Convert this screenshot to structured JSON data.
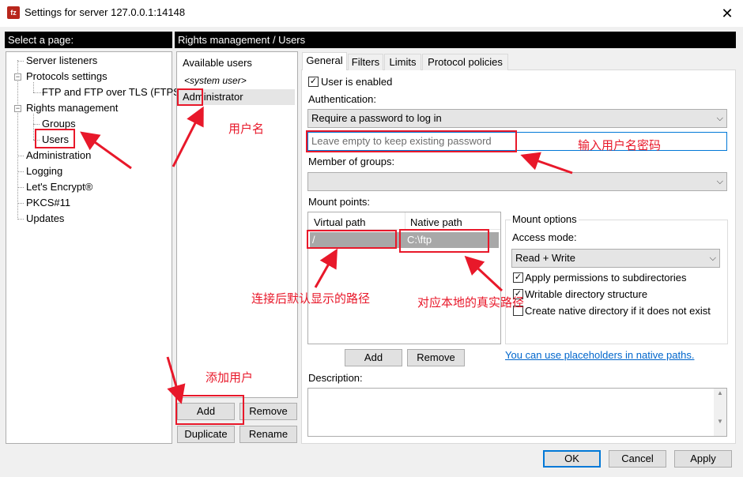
{
  "window": {
    "title": "Settings for server 127.0.0.1:14148",
    "app_icon": "fz",
    "close": "✕"
  },
  "left_pane": {
    "header": "Select a page:",
    "tree": [
      {
        "label": "Server listeners"
      },
      {
        "label": "Protocols settings"
      },
      {
        "label": "FTP and FTP over TLS (FTPS)"
      },
      {
        "label": "Rights management"
      },
      {
        "label": "Groups"
      },
      {
        "label": "Users"
      },
      {
        "label": "Administration"
      },
      {
        "label": "Logging"
      },
      {
        "label": "Let's Encrypt®"
      },
      {
        "label": "PKCS#11"
      },
      {
        "label": "Updates"
      }
    ]
  },
  "right_header": "Rights management / Users",
  "users_panel": {
    "title": "Available users",
    "items": [
      "<system user>",
      "Administrator"
    ],
    "buttons": {
      "add": "Add",
      "remove": "Remove",
      "duplicate": "Duplicate",
      "rename": "Rename"
    }
  },
  "tabs": [
    "General",
    "Filters",
    "Limits",
    "Protocol policies"
  ],
  "general": {
    "user_enabled": "User is enabled",
    "authentication_label": "Authentication:",
    "authentication_value": "Require a password to log in",
    "password_placeholder": "Leave empty to keep existing password",
    "member_of_groups": "Member of groups:",
    "mount_points_label": "Mount points:",
    "mount_columns": [
      "Virtual path",
      "Native path"
    ],
    "mount_row": {
      "virtual": "/",
      "native": "C:\\ftp"
    },
    "mount_add": "Add",
    "mount_remove": "Remove",
    "mount_options": {
      "title": "Mount options",
      "access_mode_label": "Access mode:",
      "access_mode_value": "Read + Write",
      "apply_permissions": "Apply permissions to subdirectories",
      "writable_structure": "Writable directory structure",
      "create_native": "Create native directory if it does not exist"
    },
    "placeholders_link": "You can use placeholders in native paths.",
    "description_label": "Description:"
  },
  "footer": {
    "ok": "OK",
    "cancel": "Cancel",
    "apply": "Apply"
  },
  "annotations": {
    "username": "用户名",
    "enter_credentials": "输入用户名密码",
    "default_path": "连接后默认显示的路径",
    "local_path": "对应本地的真实路径",
    "add_user": "添加用户"
  },
  "colors": {
    "accent": "#0078d7",
    "annotation_red": "#e8182a",
    "selection": "#a8a8a8"
  }
}
